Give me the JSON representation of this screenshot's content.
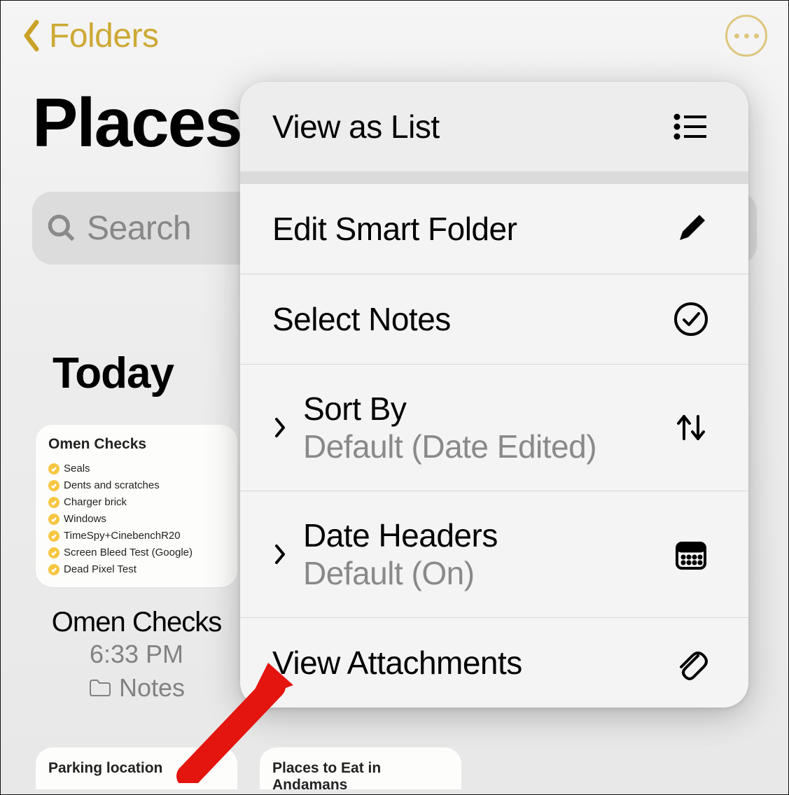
{
  "nav": {
    "back_label": "Folders"
  },
  "page_title": "Places",
  "search": {
    "placeholder": "Search"
  },
  "section_header": "Today",
  "note_preview": {
    "title": "Omen Checks",
    "items": [
      "Seals",
      "Dents and scratches",
      "Charger brick",
      "Windows",
      "TimeSpy+CinebenchR20",
      "Screen Bleed Test (Google)",
      "Dead Pixel Test"
    ]
  },
  "note_meta": {
    "title": "Omen Checks",
    "time": "6:33 PM",
    "folder": "Notes"
  },
  "bottom_cards": [
    "Parking location",
    "Places to Eat in Andamans"
  ],
  "menu": {
    "view_as_list": "View as List",
    "edit_smart_folder": "Edit Smart Folder",
    "select_notes": "Select Notes",
    "sort_by_title": "Sort By",
    "sort_by_sub": "Default (Date Edited)",
    "date_headers_title": "Date Headers",
    "date_headers_sub": "Default (On)",
    "view_attachments": "View Attachments"
  }
}
